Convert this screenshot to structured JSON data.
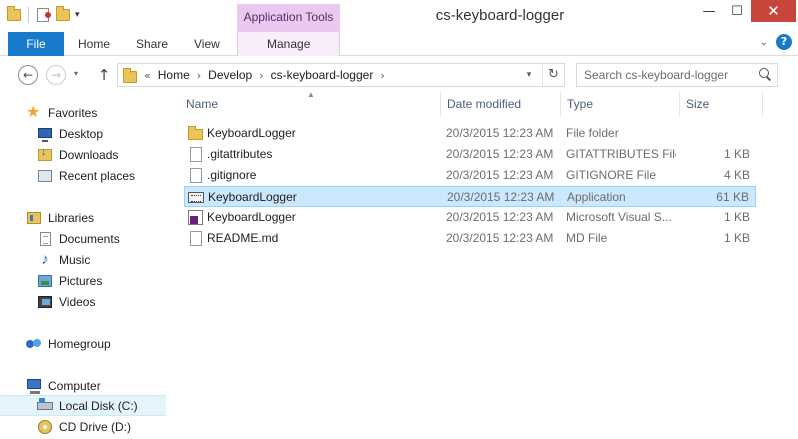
{
  "window": {
    "title": "cs-keyboard-logger",
    "contextual_tab": "Application Tools",
    "minimize": "—",
    "maximize": "☐",
    "close": "✕"
  },
  "ribbon": {
    "tabs": [
      "File",
      "Home",
      "Share",
      "View",
      "Manage"
    ],
    "expand": "⌄",
    "help": "?"
  },
  "address": {
    "overflow": "«",
    "breadcrumb": [
      "Home",
      "Develop",
      "cs-keyboard-logger"
    ],
    "separator": "›",
    "dropdown": "▾",
    "refresh": "↻"
  },
  "nav_buttons": {
    "back": "←",
    "forward": "→",
    "recent": "▾",
    "up": "↑"
  },
  "search": {
    "placeholder": "Search cs-keyboard-logger"
  },
  "sidebar": {
    "favorites": {
      "label": "Favorites",
      "items": [
        "Desktop",
        "Downloads",
        "Recent places"
      ]
    },
    "libraries": {
      "label": "Libraries",
      "items": [
        "Documents",
        "Music",
        "Pictures",
        "Videos"
      ]
    },
    "homegroup": {
      "label": "Homegroup"
    },
    "computer": {
      "label": "Computer",
      "items": [
        "Local Disk (C:)",
        "CD Drive (D:)"
      ]
    }
  },
  "columns": {
    "name": "Name",
    "date": "Date modified",
    "type": "Type",
    "size": "Size",
    "sort_indicator": "▲"
  },
  "files": [
    {
      "name": "KeyboardLogger",
      "date": "20/3/2015 12:23 AM",
      "type": "File folder",
      "size": "",
      "icon": "folder-icon"
    },
    {
      "name": ".gitattributes",
      "date": "20/3/2015 12:23 AM",
      "type": "GITATTRIBUTES File",
      "size": "1 KB",
      "icon": "file-icon"
    },
    {
      "name": ".gitignore",
      "date": "20/3/2015 12:23 AM",
      "type": "GITIGNORE File",
      "size": "4 KB",
      "icon": "file-icon"
    },
    {
      "name": "KeyboardLogger",
      "date": "20/3/2015 12:23 AM",
      "type": "Application",
      "size": "61 KB",
      "icon": "application-icon"
    },
    {
      "name": "KeyboardLogger",
      "date": "20/3/2015 12:23 AM",
      "type": "Microsoft Visual S...",
      "size": "1 KB",
      "icon": "visual-studio-solution-icon"
    },
    {
      "name": "README.md",
      "date": "20/3/2015 12:23 AM",
      "type": "MD File",
      "size": "1 KB",
      "icon": "file-icon"
    }
  ],
  "colors": {
    "file_tab": "#1979ca",
    "contextual_tab": "#e9c9ef",
    "close_button": "#c7453a",
    "selection": "#cce8ff",
    "selection_border": "#99d1ff"
  }
}
